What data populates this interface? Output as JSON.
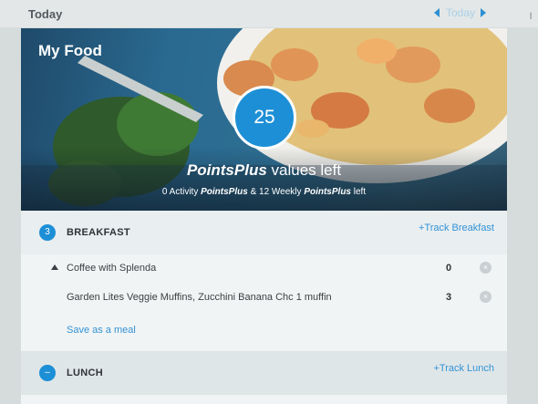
{
  "header": {
    "title": "Today",
    "date_label": "Today"
  },
  "hero": {
    "title": "My Food",
    "points_value": "25",
    "points_brand": "PointsPlus",
    "points_heading_rest": " values left",
    "sub_activity": "0 Activity ",
    "sub_brand_1": "PointsPlus",
    "sub_mid": " & 12 Weekly ",
    "sub_brand_2": "PointsPlus",
    "sub_end": " left"
  },
  "breakfast": {
    "badge": "3",
    "name": "BREAKFAST",
    "track_label": "+Track Breakfast",
    "items": [
      {
        "name": "Coffee with Splenda",
        "points": "0"
      },
      {
        "name": "Garden Lites Veggie Muffins, Zucchini Banana Chc  1 muffin",
        "points": "3"
      }
    ],
    "save_label": "Save as a meal"
  },
  "lunch": {
    "badge": "–",
    "name": "LUNCH",
    "track_label": "+Track Lunch"
  },
  "colors": {
    "accent": "#1d8fd6",
    "link": "#3393d6"
  },
  "icons": {
    "date_prev": "triangle-left-icon",
    "date_next": "triangle-right-icon",
    "remove": "remove-circle-icon",
    "expand": "caret-up-icon"
  }
}
